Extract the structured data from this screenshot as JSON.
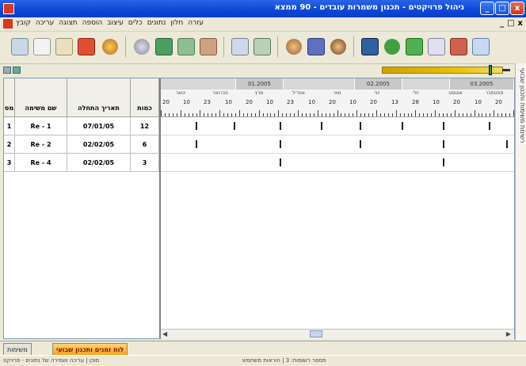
{
  "window": {
    "title": "ניהול פרויקטים - תכנון משמרות עובדים - 90 ממצא",
    "controls": [
      "_",
      "□",
      "x"
    ]
  },
  "menubar": {
    "items": [
      "קובץ",
      "עריכה",
      "תצוגה",
      "הוספה",
      "עיצוב",
      "כלים",
      "נתונים",
      "חלון",
      "עזרה"
    ],
    "mdi_controls": [
      "_",
      "□",
      "x"
    ]
  },
  "toolbar": {
    "icons": [
      "new-icon",
      "copy-icon",
      "paste-icon",
      "delete-icon",
      "paint-icon",
      "settings-icon",
      "export-icon",
      "print-icon",
      "filter-icon",
      "calendar-icon",
      "table-icon",
      "user-icon",
      "group-icon",
      "user-add-icon",
      "report-icon",
      "chart-icon",
      "tree-icon",
      "document-icon",
      "presentation-icon",
      "grid-icon"
    ]
  },
  "zoom": {
    "level": 0.9
  },
  "side_panel": {
    "label": "רשימת משימות ותכנון שבועי"
  },
  "table": {
    "headers": [
      "מס",
      "שם משימה",
      "תאריך התחלה",
      "כמות"
    ],
    "rows": [
      {
        "num": "1",
        "name": "Re - 1",
        "date": "07/01/05",
        "count": "12"
      },
      {
        "num": "2",
        "name": "Re - 2",
        "date": "02/02/05",
        "count": "6"
      },
      {
        "num": "3",
        "name": "Re - 4",
        "date": "02/02/05",
        "count": "3"
      }
    ]
  },
  "gantt": {
    "months": [
      "01.2005",
      "02.2005",
      "03.2005"
    ],
    "weeks": [
      "ינואר",
      "פברואר",
      "מרץ",
      "אפריל",
      "מאי",
      "יוני",
      "יולי",
      "אוגוסט",
      "ספטמבר"
    ],
    "days": [
      "20",
      "10",
      "23",
      "10",
      "20",
      "10",
      "23",
      "10",
      "20",
      "10",
      "20",
      "13",
      "28",
      "10",
      "20",
      "10",
      "20"
    ],
    "row_marks": [
      [
        0.1,
        0.21,
        0.34,
        0.46,
        0.57,
        0.69,
        0.81,
        0.94
      ],
      [
        0.1,
        0.34,
        0.57,
        0.81,
        0.99
      ],
      [
        0.34,
        0.81
      ]
    ]
  },
  "tabs": [
    {
      "label": "משימות",
      "active": false
    },
    {
      "label": "לוח זמנים ותכנון שבועי",
      "active": true
    }
  ],
  "status": {
    "left": "מוכן | עריכה ושמירה של נתונים - פרויקט",
    "right": "מספר רשומות: 3 | הוראות משתמש"
  }
}
